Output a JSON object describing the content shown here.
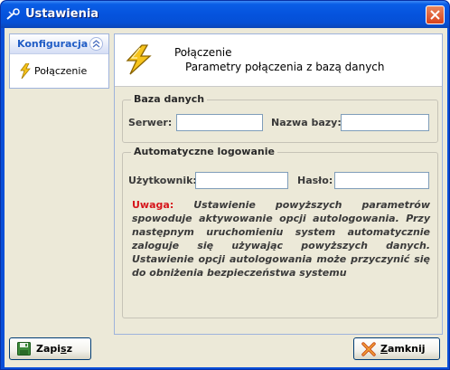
{
  "window": {
    "title": "Ustawienia"
  },
  "sidebar": {
    "header": "Konfiguracja",
    "items": [
      {
        "label": "Połączenie",
        "icon": "lightning-icon"
      }
    ]
  },
  "header": {
    "title": "Połączenie",
    "subtitle": "Parametry połączenia z bazą danych"
  },
  "database_group": {
    "legend": "Baza danych",
    "server_label": "Serwer:",
    "server_value": "",
    "dbname_label": "Nazwa bazy:",
    "dbname_value": ""
  },
  "autologin_group": {
    "legend": "Automatyczne logowanie",
    "user_label": "Użytkownik:",
    "user_value": "",
    "password_label": "Hasło:",
    "password_value": "",
    "warning_prefix": "Uwaga:",
    "warning_text": " Ustawienie powyższych parametrów spowoduje aktywowanie opcji autologowania. Przy następnym uruchomieniu system automatycznie zaloguje się używając powyższych danych. Ustawienie opcji autologowania może przyczynić się do obniżenia bezpieczeństwa systemu"
  },
  "buttons": {
    "save_pre": "Zapi",
    "save_mnemonic": "s",
    "save_post": "z",
    "close_pre": "",
    "close_mnemonic": "Z",
    "close_post": "amknij"
  },
  "colors": {
    "titlebar": "#0553dd",
    "panel_bg": "#ece9d8",
    "warning_red": "#d6161c",
    "close_button": "#d8421b"
  }
}
